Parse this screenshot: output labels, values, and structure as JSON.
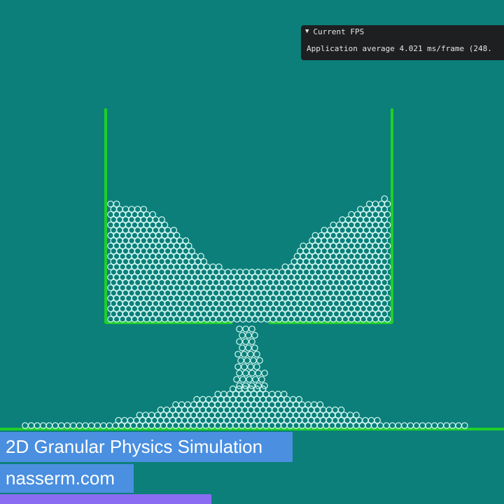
{
  "fps_window": {
    "header": "Current FPS",
    "line": "Application average 4.021 ms/frame (248."
  },
  "captions": {
    "title": "2D Granular Physics Simulation",
    "site": "nasserm.com"
  },
  "progress": {
    "fraction": 0.42
  },
  "colors": {
    "background": "#0c7f7a",
    "walls": "#1fcf2a",
    "particle_outline": "#d8fbf5",
    "caption_bg": "#4a8fe0",
    "progress": "#8a6cf2"
  },
  "icons": {
    "collapse": "triangle-down-icon"
  }
}
